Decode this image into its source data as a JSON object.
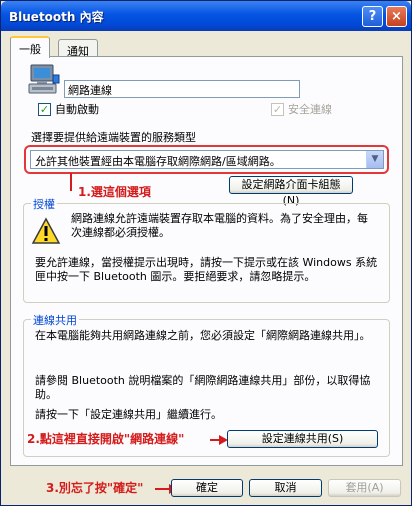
{
  "window": {
    "title": "Bluetooth 內容",
    "help_glyph": "?",
    "close_glyph": "×"
  },
  "tabs": [
    {
      "label": "一般"
    },
    {
      "label": "通知"
    }
  ],
  "connection": {
    "name_value": "網路連線",
    "auto_start_label": "自動啟動",
    "auto_start_checked": true,
    "secure_label": "安全連線",
    "secure_checked": true
  },
  "service": {
    "prompt": "選擇要提供給遠端裝置的服務類型",
    "selected_option": "允許其他裝置經由本電腦存取網際網路/區域網路。",
    "config_button": "設定網路介面卡組態(N)"
  },
  "authorization": {
    "title": "授權",
    "text1": "網路連線允許遠端裝置存取本電腦的資料。為了安全理由，每次連線都必須授權。",
    "text2": "要允許連線，當授權提示出現時，請按一下提示或在該 Windows 系統匣中按一下 Bluetooth 圖示。要拒絕要求，請忽略提示。"
  },
  "ics": {
    "title": "連線共用",
    "text1": "在本電腦能夠共用網路連線之前，您必須設定「網際網路連線共用」。",
    "text2": "請參閱 Bluetooth 說明檔案的「網際網路連線共用」部份，以取得協助。",
    "text3": "請按一下「設定連線共用」繼續進行。",
    "setup_button": "設定連線共用(S)"
  },
  "annotations": {
    "step1": "1.選這個選項",
    "step2": "2.點這裡直接開啟\"網路連線\"",
    "step3": "3.別忘了按\"確定\""
  },
  "footer": {
    "ok": "確定",
    "cancel": "取消",
    "apply": "套用(A)"
  },
  "colors": {
    "annotation": "#d41c1c",
    "title_blue": "#0554e3",
    "group_title": "#0046d5"
  }
}
